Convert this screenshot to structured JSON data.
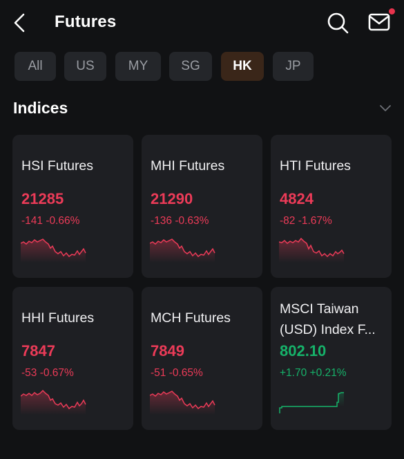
{
  "header": {
    "title": "Futures",
    "back_icon": "chevron-left-icon",
    "search_icon": "search-icon",
    "mail_icon": "mail-icon"
  },
  "tabs": [
    {
      "label": "All"
    },
    {
      "label": "US"
    },
    {
      "label": "MY"
    },
    {
      "label": "SG"
    },
    {
      "label": "HK",
      "active": true
    },
    {
      "label": "JP"
    }
  ],
  "section": {
    "title": "Indices",
    "collapse_icon": "chevron-down-icon"
  },
  "colors": {
    "down": "#ec3b58",
    "up": "#16b36a",
    "accent_tab_bg": "#3a2619",
    "notification_dot": "#e8334d"
  },
  "cards": [
    {
      "name": "HSI Futures",
      "price": "21285",
      "change": "-141 -0.66%",
      "direction": "down"
    },
    {
      "name": "MHI Futures",
      "price": "21290",
      "change": "-136 -0.63%",
      "direction": "down"
    },
    {
      "name": "HTI Futures",
      "price": "4824",
      "change": "-82 -1.67%",
      "direction": "down"
    },
    {
      "name": "HHI Futures",
      "price": "7847",
      "change": "-53 -0.67%",
      "direction": "down"
    },
    {
      "name": "MCH Futures",
      "price": "7849",
      "change": "-51 -0.65%",
      "direction": "down"
    },
    {
      "name_line1": "MSCI Taiwan",
      "name_line2": "(USD) Index F...",
      "price": "802.10",
      "change": "+1.70 +0.21%",
      "direction": "up"
    }
  ]
}
